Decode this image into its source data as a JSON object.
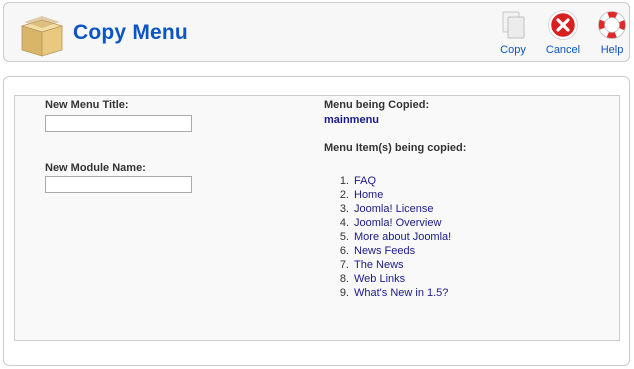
{
  "header": {
    "title": "Copy Menu",
    "icon": "package-box-icon"
  },
  "toolbar": {
    "copy_label": "Copy",
    "cancel_label": "Cancel",
    "help_label": "Help"
  },
  "form": {
    "new_menu_title_label": "New Menu Title:",
    "new_menu_title_value": "",
    "new_module_name_label": "New Module Name:",
    "new_module_name_value": ""
  },
  "info": {
    "menu_copied_label": "Menu being Copied:",
    "menu_copied_value": "mainmenu",
    "items_label": "Menu Item(s) being copied:",
    "items": [
      {
        "num": "1.",
        "label": "FAQ"
      },
      {
        "num": "2.",
        "label": "Home"
      },
      {
        "num": "3.",
        "label": "Joomla! License"
      },
      {
        "num": "4.",
        "label": "Joomla! Overview"
      },
      {
        "num": "5.",
        "label": "More about Joomla!"
      },
      {
        "num": "6.",
        "label": "News Feeds"
      },
      {
        "num": "7.",
        "label": "The News"
      },
      {
        "num": "8.",
        "label": "Web Links"
      },
      {
        "num": "9.",
        "label": "What's New in 1.5?"
      }
    ]
  },
  "colors": {
    "accent": "#0b55c4",
    "link": "#1a1a8a",
    "border": "#cccccc"
  }
}
